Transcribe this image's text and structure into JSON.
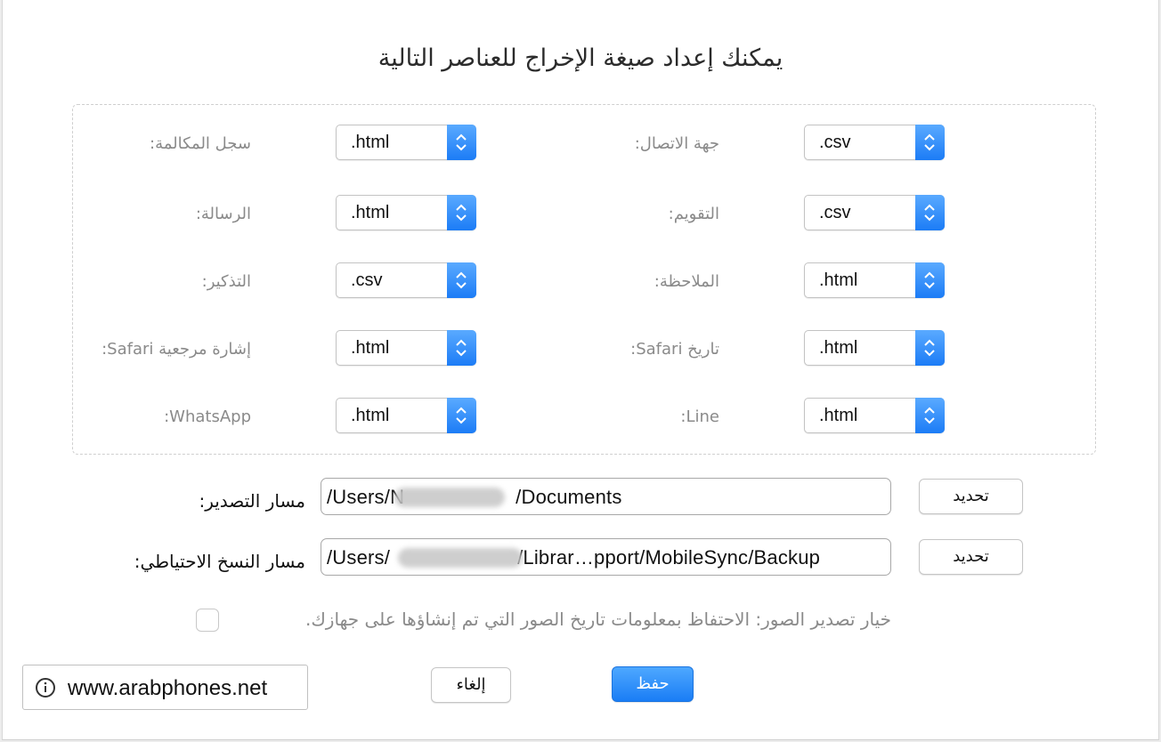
{
  "dialog": {
    "title": "يمكنك إعداد صيغة الإخراج للعناصر التالية"
  },
  "formats": {
    "contact": {
      "label": "جهة الاتصال:",
      "value": ".csv"
    },
    "call_log": {
      "label": "سجل المكالمة:",
      "value": ".html"
    },
    "calendar": {
      "label": "التقويم:",
      "value": ".csv"
    },
    "message": {
      "label": "الرسالة:",
      "value": ".html"
    },
    "note": {
      "label": "الملاحظة:",
      "value": ".html"
    },
    "reminder": {
      "label": "التذكير:",
      "value": ".csv"
    },
    "safari_history": {
      "label": "تاريخ Safari:",
      "value": ".html"
    },
    "safari_bookmark": {
      "label": "إشارة مرجعية Safari:",
      "value": ".html"
    },
    "line": {
      "label": "Line:",
      "value": ".html"
    },
    "whatsapp": {
      "label": "WhatsApp:",
      "value": ".html"
    }
  },
  "paths": {
    "export": {
      "label": "مسار التصدير:",
      "value_start": "/Users/N",
      "value_end": "/Documents",
      "button": "تحديد"
    },
    "backup": {
      "label": "مسار النسخ الاحتياطي:",
      "value_start": "/Users/",
      "value_end": "/Librar…pport/MobileSync/Backup",
      "button": "تحديد"
    }
  },
  "photo_option": {
    "label": "خيار تصدير الصور: الاحتفاظ بمعلومات تاريخ الصور التي تم إنشاؤها على جهازك.",
    "checked": false
  },
  "buttons": {
    "save": "حفظ",
    "cancel": "إلغاء"
  },
  "watermark": {
    "icon": "info-icon",
    "text": "www.arabphones.net"
  },
  "colors": {
    "accent": "#1a7df5",
    "label_gray": "#8a8a8a"
  }
}
